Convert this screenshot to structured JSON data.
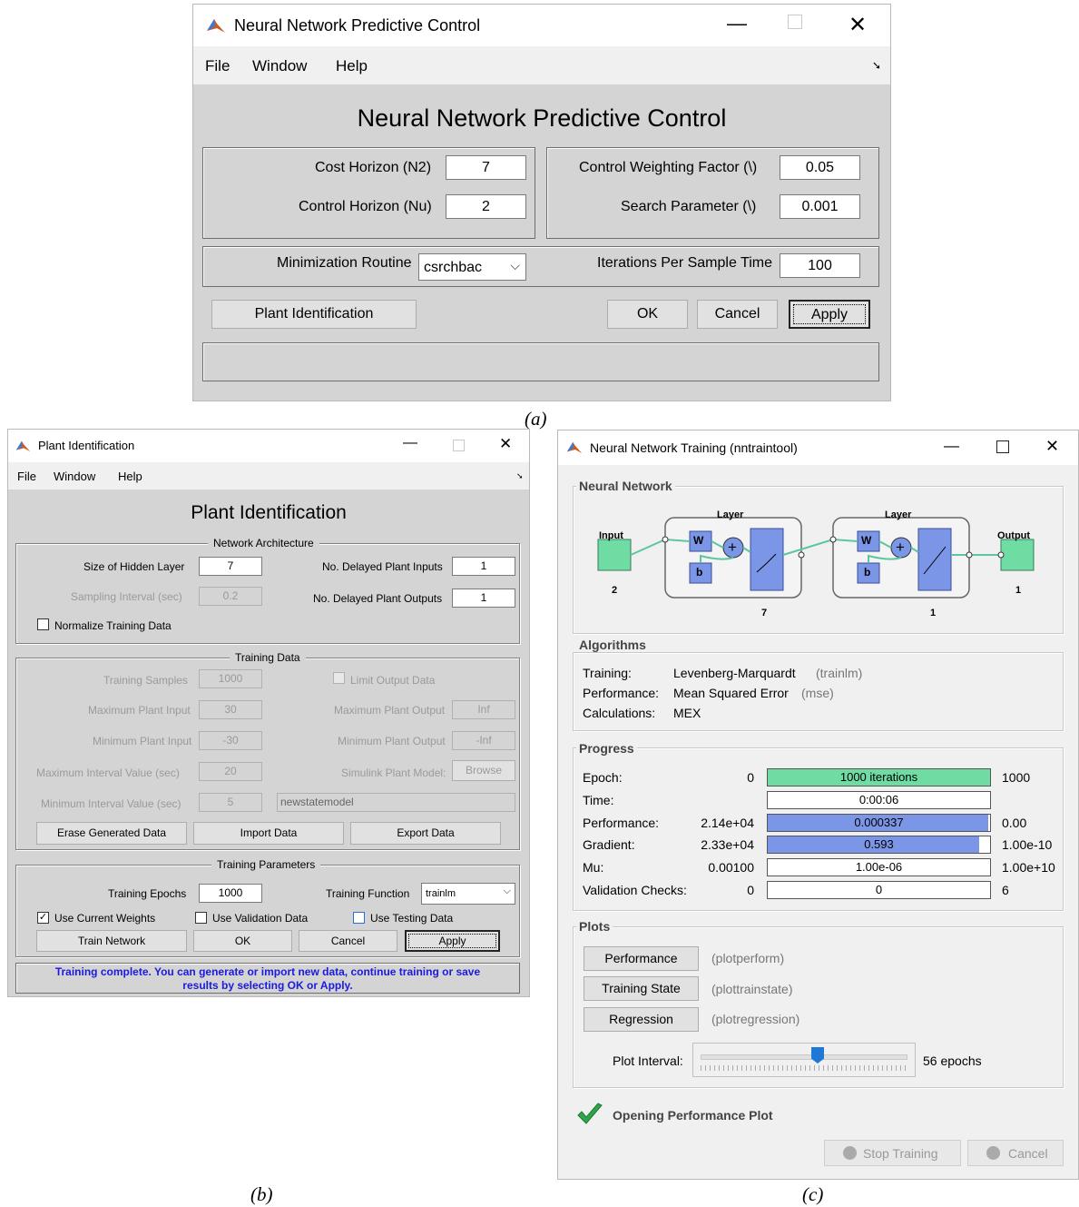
{
  "win_a": {
    "title": "Neural Network Predictive Control",
    "menu": [
      "File",
      "Window",
      "Help"
    ],
    "heading": "Neural Network Predictive Control",
    "cost_horizon_label": "Cost Horizon (N2)",
    "cost_horizon_value": "7",
    "control_horizon_label": "Control Horizon (Nu)",
    "control_horizon_value": "2",
    "weighting_label": "Control Weighting Factor (\\)",
    "weighting_value": "0.05",
    "search_label": "Search Parameter (\\)",
    "search_value": "0.001",
    "min_routine_label": "Minimization Routine",
    "min_routine_value": "csrchbac",
    "iterations_label": "Iterations Per Sample Time",
    "iterations_value": "100",
    "plant_id_button": "Plant Identification",
    "ok_button": "OK",
    "cancel_button": "Cancel",
    "apply_button": "Apply"
  },
  "win_b": {
    "title": "Plant Identification",
    "menu": [
      "File",
      "Window",
      "Help"
    ],
    "heading": "Plant Identification",
    "network_architecture": "Network Architecture",
    "hidden_layer_label": "Size of Hidden Layer",
    "hidden_layer_value": "7",
    "delayed_inputs_label": "No. Delayed Plant Inputs",
    "delayed_inputs_value": "1",
    "sampling_label": "Sampling Interval (sec)",
    "sampling_value": "0.2",
    "delayed_outputs_label": "No. Delayed Plant Outputs",
    "delayed_outputs_value": "1",
    "normalize_label": "Normalize Training Data",
    "training_data": "Training Data",
    "samples_label": "Training Samples",
    "samples_value": "1000",
    "limit_output_label": "Limit Output Data",
    "max_input_label": "Maximum Plant Input",
    "max_input_value": "30",
    "max_output_label": "Maximum Plant Output",
    "max_output_value": "Inf",
    "min_input_label": "Minimum Plant Input",
    "min_input_value": "-30",
    "min_output_label": "Minimum Plant Output",
    "min_output_value": "-Inf",
    "max_interval_label": "Maximum Interval Value (sec)",
    "max_interval_value": "20",
    "simulink_label": "Simulink Plant Model:",
    "browse_button": "Browse",
    "min_interval_label": "Minimum Interval Value (sec)",
    "min_interval_value": "5",
    "model_value": "newstatemodel",
    "erase_button": "Erase Generated Data",
    "import_button": "Import Data",
    "export_button": "Export Data",
    "training_parameters": "Training Parameters",
    "epochs_label": "Training Epochs",
    "epochs_value": "1000",
    "function_label": "Training Function",
    "function_value": "trainlm",
    "use_weights_label": "Use Current Weights",
    "use_validation_label": "Use Validation Data",
    "use_testing_label": "Use Testing Data",
    "train_button": "Train Network",
    "ok_button": "OK",
    "cancel_button": "Cancel",
    "apply_button": "Apply",
    "status_line1": "Training complete. You can generate or import new data, continue training or save",
    "status_line2": "results by selecting OK or Apply."
  },
  "win_c": {
    "title": "Neural Network Training (nntraintool)",
    "nn_section": "Neural Network",
    "layer_label": "Layer",
    "input_label": "Input",
    "input_size": "2",
    "layer1_size": "7",
    "layer2_size": "1",
    "output_label": "Output",
    "output_size": "1",
    "w_label": "W",
    "b_label": "b",
    "plus": "+",
    "algorithms_section": "Algorithms",
    "training_label": "Training:",
    "training_value": "Levenberg-Marquardt",
    "training_fn": "(trainlm)",
    "performance_label": "Performance:",
    "performance_value": "Mean Squared Error",
    "performance_fn": "(mse)",
    "calculations_label": "Calculations:",
    "calculations_value": "MEX",
    "progress_section": "Progress",
    "rows": [
      {
        "label": "Epoch:",
        "left": "0",
        "bar": "1000 iterations",
        "right": "1000",
        "fill": 1.0,
        "color": "#6fdca4"
      },
      {
        "label": "Time:",
        "left": "",
        "bar": "0:00:06",
        "right": "",
        "fill": 0,
        "color": "#ffffff"
      },
      {
        "label": "Performance:",
        "left": "2.14e+04",
        "bar": "0.000337",
        "right": "0.00",
        "fill": 0.99,
        "color": "#7b96e6"
      },
      {
        "label": "Gradient:",
        "left": "2.33e+04",
        "bar": "0.593",
        "right": "1.00e-10",
        "fill": 0.95,
        "color": "#7b96e6"
      },
      {
        "label": "Mu:",
        "left": "0.00100",
        "bar": "1.00e-06",
        "right": "1.00e+10",
        "fill": 0,
        "color": "#ffffff"
      },
      {
        "label": "Validation Checks:",
        "left": "0",
        "bar": "0",
        "right": "6",
        "fill": 0,
        "color": "#ffffff"
      }
    ],
    "plots_section": "Plots",
    "plot_performance": "Performance",
    "plot_performance_fn": "(plotperform)",
    "plot_training_state": "Training State",
    "plot_training_state_fn": "(plottrainstate)",
    "plot_regression": "Regression",
    "plot_regression_fn": "(plotregression)",
    "plot_interval_label": "Plot Interval:",
    "plot_interval_value": "56 epochs",
    "status": "Opening Performance Plot",
    "stop_button": "Stop Training",
    "cancel_button": "Cancel"
  },
  "captions": {
    "a": "(a)",
    "b": "(b)",
    "c": "(c)"
  }
}
